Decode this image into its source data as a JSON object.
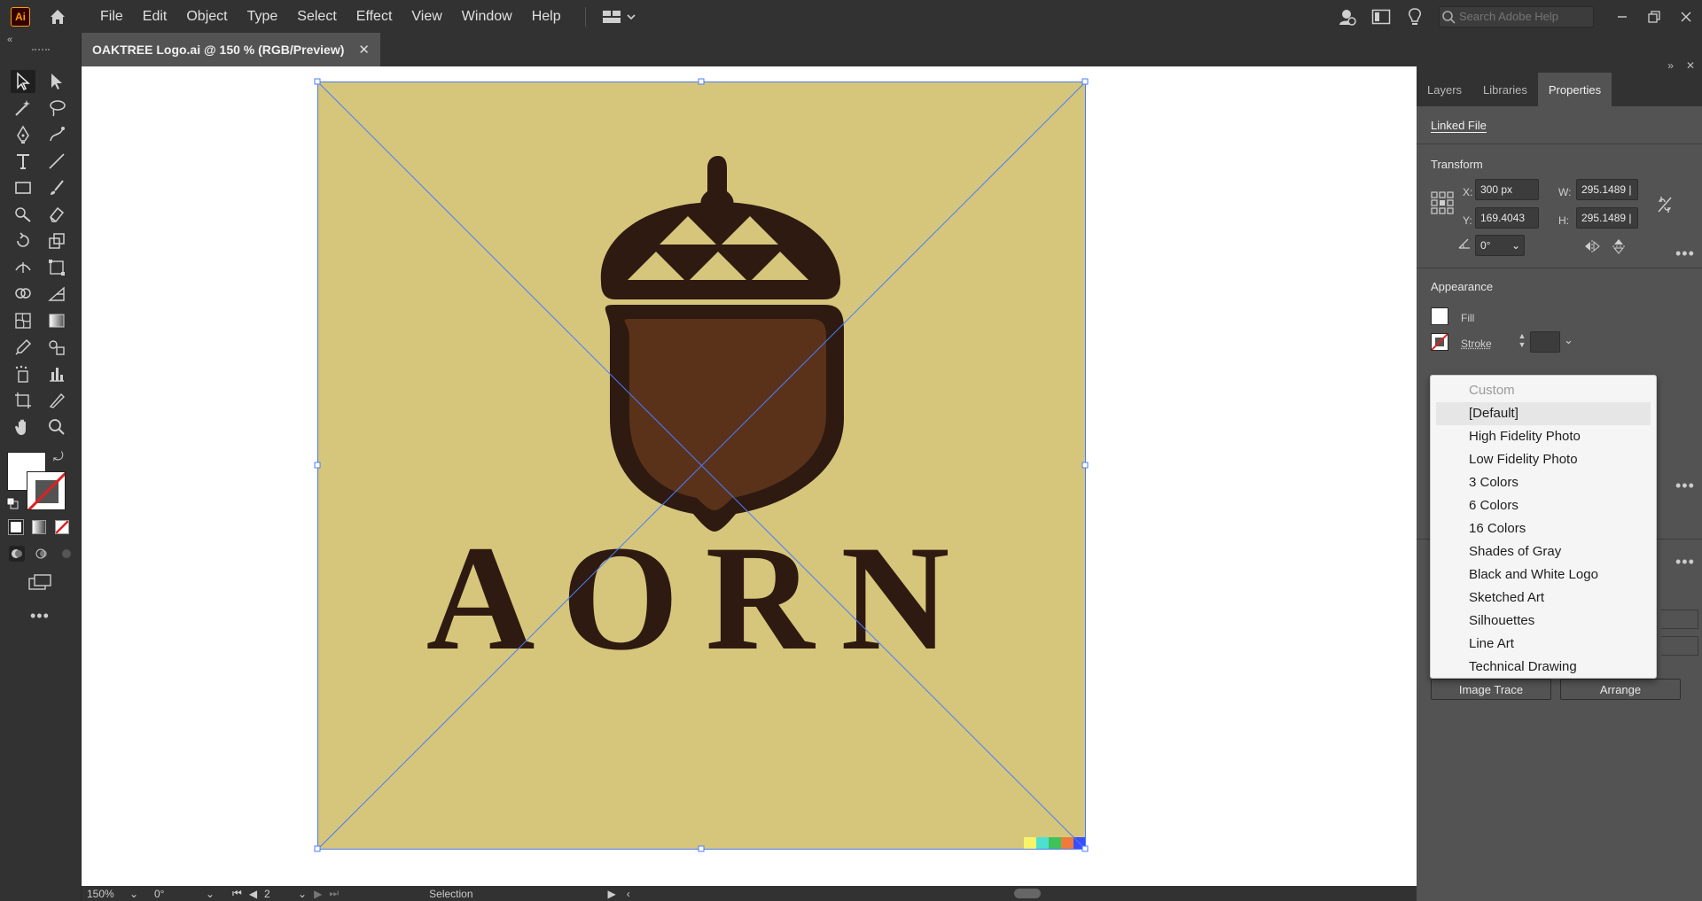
{
  "app": {
    "logo_text": "Ai",
    "menu": [
      "File",
      "Edit",
      "Object",
      "Type",
      "Select",
      "Effect",
      "View",
      "Window",
      "Help"
    ],
    "search_placeholder": "Search Adobe Help"
  },
  "document": {
    "tab_title": "OAKTREE Logo.ai @ 150 % (RGB/Preview)",
    "close_glyph": "✕"
  },
  "artwork": {
    "wordmark": "AORN",
    "background_color": "#d6c67b",
    "ink_color": "#2e1a10",
    "nut_color": "#5a321a",
    "corner_swatches": [
      "#f9f36a",
      "#4de0d0",
      "#3cc45a",
      "#f07a3c",
      "#3a4dff"
    ]
  },
  "status": {
    "zoom": "150%",
    "rotation": "0°",
    "artboard": "2",
    "tool": "Selection"
  },
  "panel": {
    "tabs": [
      "Layers",
      "Libraries",
      "Properties"
    ],
    "active_tab": "Properties",
    "linked_file": "Linked File",
    "transform": {
      "title": "Transform",
      "x_label": "X:",
      "x": "300 px",
      "y_label": "Y:",
      "y": "169.4043",
      "w_label": "W:",
      "w": "295.1489 |",
      "h_label": "H:",
      "h": "295.1489 |",
      "angle": "0°"
    },
    "appearance": {
      "title": "Appearance",
      "fill_label": "Fill",
      "stroke_label": "Stroke"
    },
    "buttons": {
      "image_trace": "Image Trace",
      "arrange": "Arrange"
    }
  },
  "trace_presets": {
    "items": [
      "Custom",
      "[Default]",
      "High Fidelity Photo",
      "Low Fidelity Photo",
      "3 Colors",
      "6 Colors",
      "16 Colors",
      "Shades of Gray",
      "Black and White Logo",
      "Sketched Art",
      "Silhouettes",
      "Line Art",
      "Technical Drawing"
    ],
    "disabled_index": 0,
    "highlight_index": 1
  }
}
